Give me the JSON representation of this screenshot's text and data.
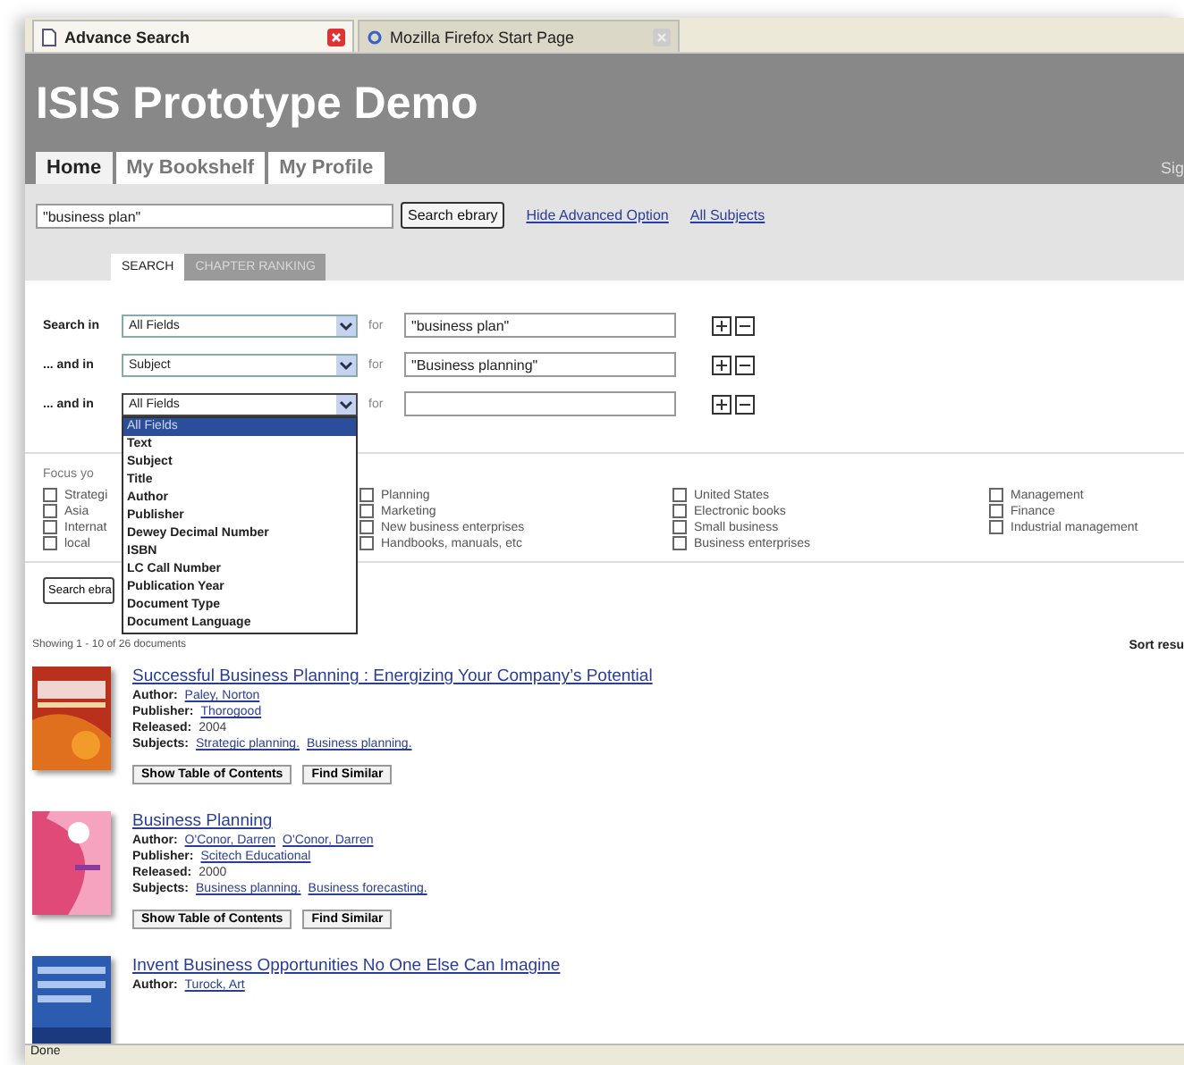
{
  "browser_tabs": [
    {
      "label": "Advance Search",
      "selected": true
    },
    {
      "label": "Mozilla Firefox Start Page",
      "selected": false
    }
  ],
  "site_title": "ISIS Prototype Demo",
  "nav_tabs": [
    {
      "label": "Home",
      "selected": true
    },
    {
      "label": "My Bookshelf",
      "selected": false
    },
    {
      "label": "My Profile",
      "selected": false
    }
  ],
  "nav_right": "Sig",
  "quick_search": {
    "value": "\"business plan\"",
    "button": "Search ebrary",
    "links": [
      "Hide Advanced Option",
      "All Subjects"
    ]
  },
  "search_tabs": [
    {
      "label": "SEARCH",
      "selected": true
    },
    {
      "label": "CHAPTER RANKING",
      "selected": false
    }
  ],
  "criteria": [
    {
      "label": "Search in",
      "field": "All Fields",
      "for": "for",
      "value": "\"business plan\"",
      "open": false
    },
    {
      "label": "... and in",
      "field": "Subject",
      "for": "for",
      "value": "\"Business planning\"",
      "open": false
    },
    {
      "label": "... and in",
      "field": "All Fields",
      "for": "for",
      "open": true
    }
  ],
  "field_options": [
    {
      "label": "All Fields",
      "selected": true
    },
    {
      "label": "Text",
      "selected": false
    },
    {
      "label": "Subject",
      "selected": false
    },
    {
      "label": "Title",
      "selected": false
    },
    {
      "label": "Author",
      "selected": false
    },
    {
      "label": "Publisher",
      "selected": false
    },
    {
      "label": "Dewey Decimal Number",
      "selected": false
    },
    {
      "label": "ISBN",
      "selected": false
    },
    {
      "label": "LC Call Number",
      "selected": false
    },
    {
      "label": "Publication Year",
      "selected": false
    },
    {
      "label": "Document Type",
      "selected": false
    },
    {
      "label": "Document Language",
      "selected": false
    }
  ],
  "focus": {
    "label": "Focus yo",
    "columns": [
      [
        {
          "label": "Strategi",
          "checked": false
        },
        {
          "label": "Asia",
          "checked": false
        },
        {
          "label": "Internat",
          "checked": false
        },
        {
          "label": "local",
          "checked": false
        }
      ],
      [
        {
          "label": "Planning",
          "checked": false
        },
        {
          "label": "Marketing",
          "checked": false
        },
        {
          "label": "New business enterprises",
          "checked": false
        },
        {
          "label": "Handbooks, manuals, etc",
          "checked": false
        }
      ],
      [
        {
          "label": "United States",
          "checked": false
        },
        {
          "label": "Electronic books",
          "checked": false
        },
        {
          "label": "Small business",
          "checked": false
        },
        {
          "label": "Business enterprises",
          "checked": false
        }
      ],
      [
        {
          "label": "Management",
          "checked": false
        },
        {
          "label": "Finance",
          "checked": false
        },
        {
          "label": "Industrial management",
          "checked": false
        }
      ]
    ]
  },
  "search_button": "Search ebra",
  "showing": "Showing 1 - 10 of 26 documents",
  "sort_label": "Sort resu",
  "results": [
    {
      "title": "Successful Business Planning : Energizing Your Company’s Potential",
      "fields": [
        {
          "label": "Author:",
          "links": [
            "Paley, Norton"
          ]
        },
        {
          "label": "Publisher:",
          "links": [
            "Thorogood"
          ]
        },
        {
          "label": "Released:",
          "value": "2004"
        },
        {
          "label": "Subjects:",
          "links": [
            "Strategic planning.",
            "Business planning."
          ]
        }
      ],
      "buttons": [
        "Show Table of Contents",
        "Find Similar"
      ]
    },
    {
      "title": "Business Planning",
      "fields": [
        {
          "label": "Author:",
          "links": [
            "O'Conor, Darren",
            "O'Conor, Darren"
          ]
        },
        {
          "label": "Publisher:",
          "links": [
            "Scitech Educational"
          ]
        },
        {
          "label": "Released:",
          "value": "2000"
        },
        {
          "label": "Subjects:",
          "links": [
            "Business planning.",
            "Business forecasting."
          ]
        }
      ],
      "buttons": [
        "Show Table of Contents",
        "Find Similar"
      ]
    },
    {
      "title": "Invent Business Opportunities No One Else Can Imagine",
      "fields": [
        {
          "label": "Author:",
          "links": [
            "Turock, Art"
          ]
        }
      ]
    }
  ],
  "status": "Done"
}
